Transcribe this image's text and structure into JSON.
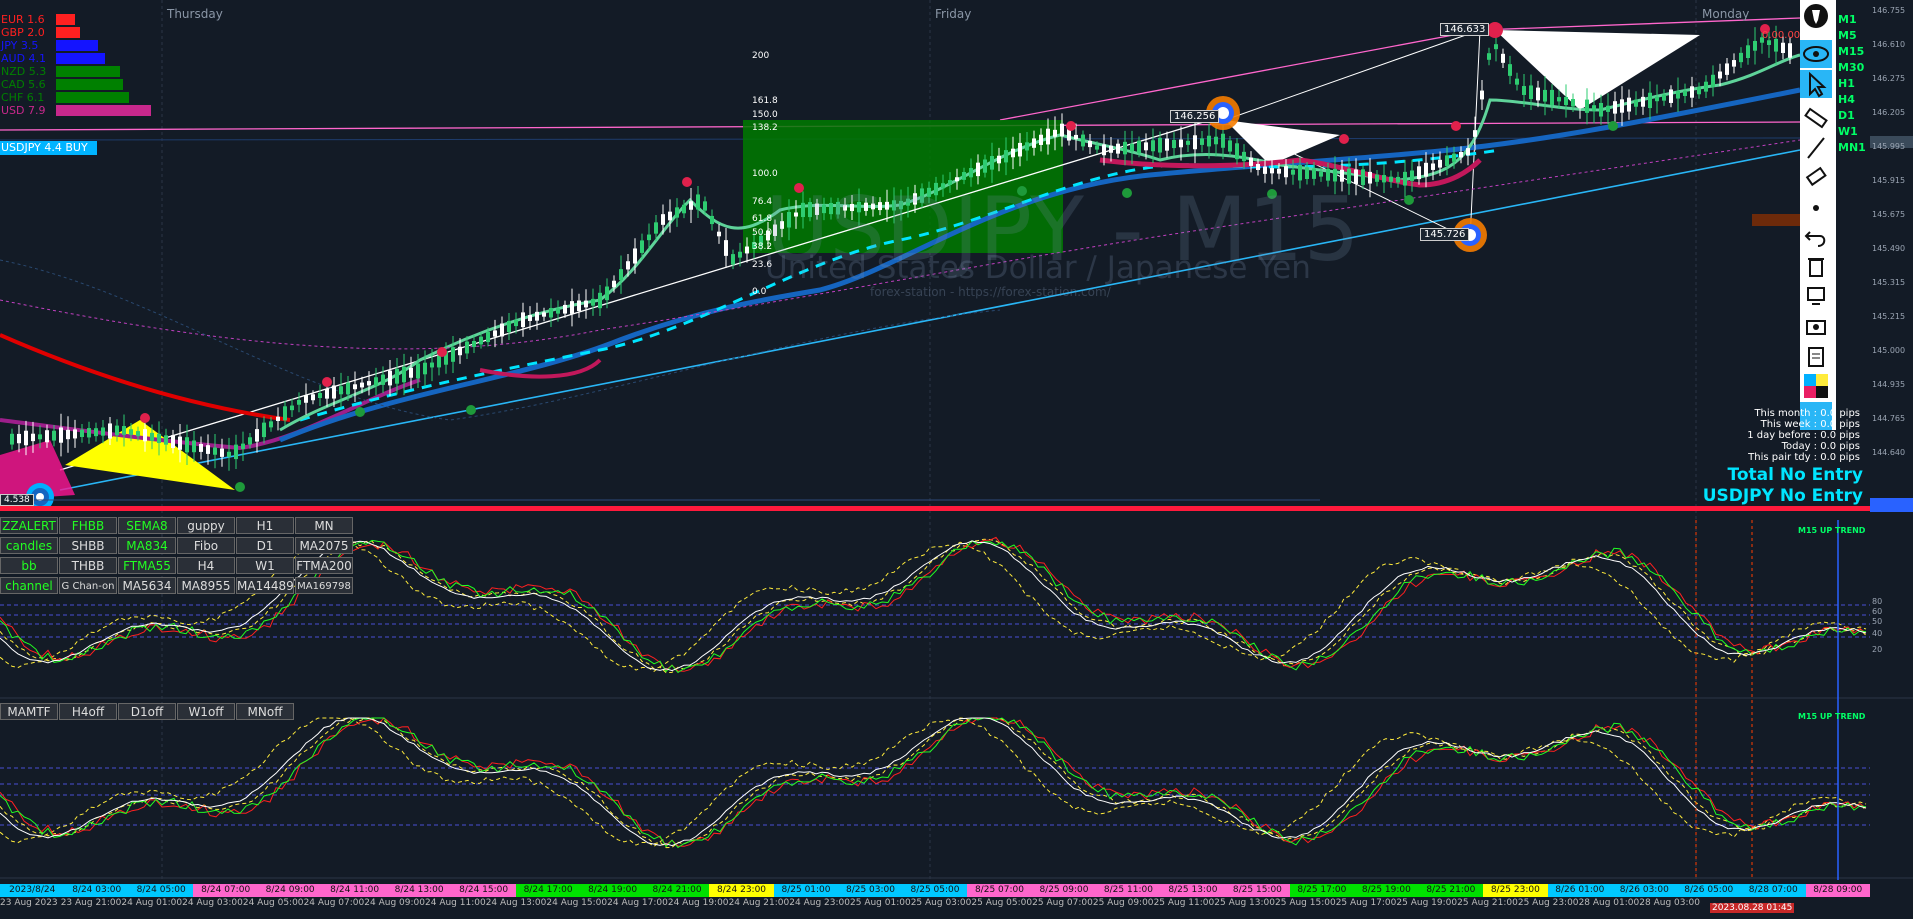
{
  "currency_strength": [
    {
      "label": "EUR",
      "value": "1.6",
      "color": "#ff2020"
    },
    {
      "label": "GBP",
      "value": "2.0",
      "color": "#ff2020"
    },
    {
      "label": "JPY",
      "value": "3.5",
      "color": "#1414ff"
    },
    {
      "label": "AUD",
      "value": "4.1",
      "color": "#1414ff"
    },
    {
      "label": "NZD",
      "value": "5.3",
      "color": "#008000"
    },
    {
      "label": "CAD",
      "value": "5.6",
      "color": "#008000"
    },
    {
      "label": "CHF",
      "value": "6.1",
      "color": "#008000"
    },
    {
      "label": "USD",
      "value": "7.9",
      "color": "#c8288c"
    }
  ],
  "pair_signal": "USDJPY 4.4 BUY",
  "days": [
    "Thursday",
    "Friday",
    "Monday"
  ],
  "watermark": {
    "title": "USDJPY - M15",
    "subtitle": "United States Dollar / Japanese Yen",
    "site": "forex-station - https://forex-station.com/"
  },
  "fib_levels": [
    "200",
    "161.8",
    "150.0",
    "138.2",
    "100.0",
    "76.4",
    "61.8",
    "50.0",
    "38.2",
    "23.6",
    "0.0"
  ],
  "price_labels": {
    "high": "146.633",
    "mid": "146.256",
    "low": "145.726",
    "left": "4.538",
    "spread": "0.00.00"
  },
  "price_axis": [
    "146.755",
    "146.610",
    "146.275",
    "146.205",
    "145.995",
    "145.915",
    "145.675",
    "145.490",
    "145.315",
    "145.215",
    "145.000",
    "144.935",
    "144.765",
    "144.640"
  ],
  "timeframes": [
    "M1",
    "M5",
    "M15",
    "M30",
    "H1",
    "H4",
    "D1",
    "W1",
    "MN1"
  ],
  "stats": [
    "This month : 0.0 pips",
    "This week : 0.0 pips",
    "1 day before : 0.0 pips",
    "Today : 0.0 pips",
    "This pair tdy : 0.0 pips"
  ],
  "total_no_entry": "Total No Entry",
  "pair_no_entry": "USDJPY No Entry",
  "buttons_grid": [
    [
      "ZZALERT",
      "FHBB",
      "SEMA8",
      "guppy",
      "H1",
      "MN"
    ],
    [
      "candles",
      "SHBB",
      "MA834",
      "Fibo",
      "D1",
      "MA2075"
    ],
    [
      "bb",
      "THBB",
      "FTMA55",
      "H4",
      "W1",
      "FTMA200"
    ],
    [
      "channel",
      "G Chan-on",
      "MA5634",
      "MA8955",
      "MA14489",
      "MA169798"
    ]
  ],
  "buttons_row2": [
    "MAMTF",
    "H4off",
    "D1off",
    "W1off",
    "MNoff"
  ],
  "indicator_label_1": "M15 UP TREND",
  "indicator_label_2": "M15 UP TREND",
  "osc_levels": [
    "80",
    "60",
    "50",
    "40",
    "20"
  ],
  "time_axis": [
    {
      "t": "2023/8/24",
      "c": "#00c8ff"
    },
    {
      "t": "8/24 03:00",
      "c": "#00c8ff"
    },
    {
      "t": "8/24 05:00",
      "c": "#00c8ff"
    },
    {
      "t": "8/24 07:00",
      "c": "#ff66cc"
    },
    {
      "t": "8/24 09:00",
      "c": "#ff66cc"
    },
    {
      "t": "8/24 11:00",
      "c": "#ff66cc"
    },
    {
      "t": "8/24 13:00",
      "c": "#ff66cc"
    },
    {
      "t": "8/24 15:00",
      "c": "#ff66cc"
    },
    {
      "t": "8/24 17:00",
      "c": "#00e000"
    },
    {
      "t": "8/24 19:00",
      "c": "#00e000"
    },
    {
      "t": "8/24 21:00",
      "c": "#00e000"
    },
    {
      "t": "8/24 23:00",
      "c": "#ffff00"
    },
    {
      "t": "8/25 01:00",
      "c": "#00c8ff"
    },
    {
      "t": "8/25 03:00",
      "c": "#00c8ff"
    },
    {
      "t": "8/25 05:00",
      "c": "#00c8ff"
    },
    {
      "t": "8/25 07:00",
      "c": "#ff66cc"
    },
    {
      "t": "8/25 09:00",
      "c": "#ff66cc"
    },
    {
      "t": "8/25 11:00",
      "c": "#ff66cc"
    },
    {
      "t": "8/25 13:00",
      "c": "#ff66cc"
    },
    {
      "t": "8/25 15:00",
      "c": "#ff66cc"
    },
    {
      "t": "8/25 17:00",
      "c": "#00e000"
    },
    {
      "t": "8/25 19:00",
      "c": "#00e000"
    },
    {
      "t": "8/25 21:00",
      "c": "#00e000"
    },
    {
      "t": "8/25 23:00",
      "c": "#ffff00"
    },
    {
      "t": "8/26 01:00",
      "c": "#00c8ff"
    },
    {
      "t": "8/26 03:00",
      "c": "#00c8ff"
    },
    {
      "t": "8/26 05:00",
      "c": "#00c8ff"
    },
    {
      "t": "8/28 07:00",
      "c": "#00c8ff"
    },
    {
      "t": "8/28 09:00",
      "c": "#ff66cc"
    }
  ],
  "date_axis": [
    "23 Aug 2023",
    "23 Aug 21:00",
    "24 Aug 01:00",
    "24 Aug 03:00",
    "24 Aug 05:00",
    "24 Aug 07:00",
    "24 Aug 09:00",
    "24 Aug 11:00",
    "24 Aug 13:00",
    "24 Aug 15:00",
    "24 Aug 17:00",
    "24 Aug 19:00",
    "24 Aug 21:00",
    "24 Aug 23:00",
    "25 Aug 01:00",
    "25 Aug 03:00",
    "25 Aug 05:00",
    "25 Aug 07:00",
    "25 Aug 09:00",
    "25 Aug 11:00",
    "25 Aug 13:00",
    "25 Aug 15:00",
    "25 Aug 17:00",
    "25 Aug 19:00",
    "25 Aug 21:00",
    "25 Aug 23:00",
    "28 Aug 01:00",
    "28 Aug 03:00"
  ],
  "current_time": "2023.08.28 01:45",
  "colors": {
    "bg": "#131b26",
    "bull": "#2ecc71",
    "fast_ma": "#5fd39a",
    "slow_ma": "#1565c0",
    "red_ma": "#e00000",
    "green_box": "#007a00"
  }
}
